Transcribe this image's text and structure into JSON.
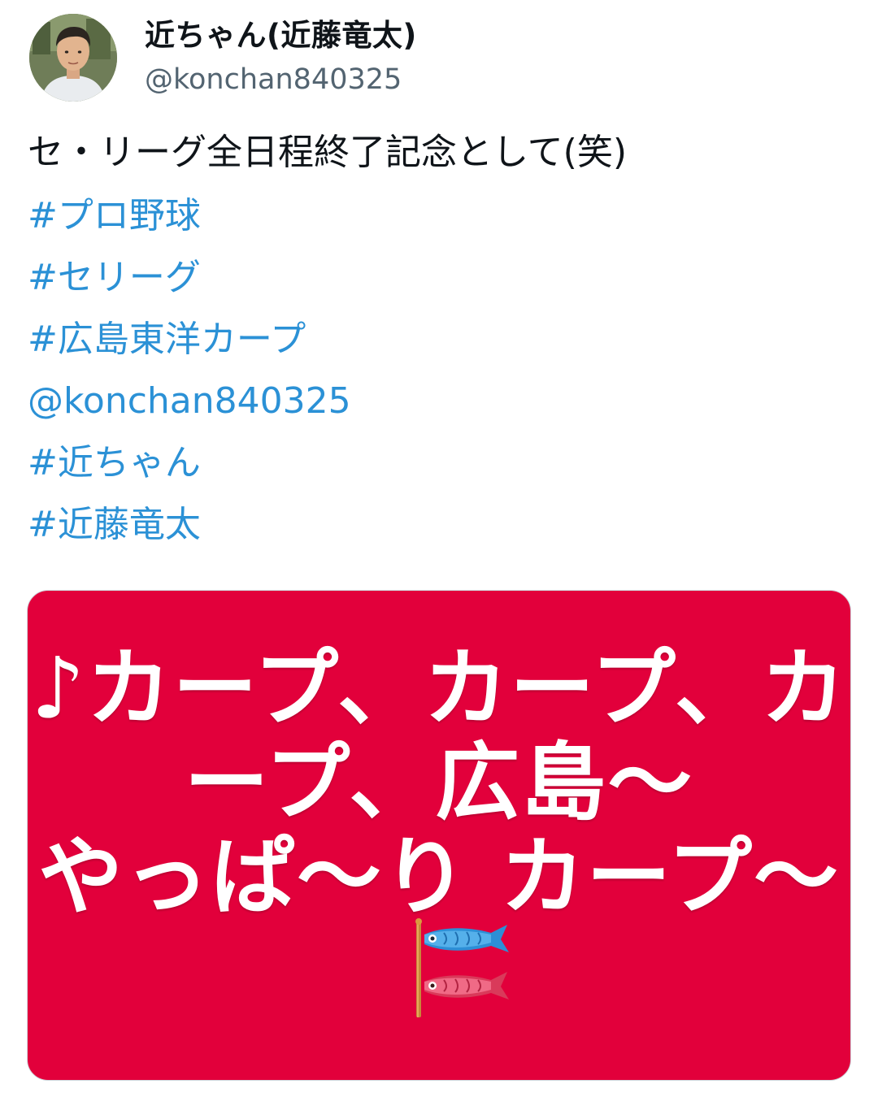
{
  "tweet": {
    "display_name": "近ちゃん(近藤竜太)",
    "handle": "@konchan840325",
    "text": "セ・リーグ全日程終了記念として(笑)",
    "tags": [
      "#プロ野球",
      "#セリーグ",
      "#広島東洋カープ",
      "@konchan840325",
      "#近ちゃん",
      "#近藤竜太"
    ]
  },
  "media": {
    "lines": [
      "♪カープ、カープ、カ",
      "ープ、広島〜",
      "やっぱ〜り カープ〜"
    ],
    "emoji_icon": "carp-streamer-icon",
    "background_color": "#e2003b",
    "text_color": "#ffffff"
  },
  "colors": {
    "link": "#2b91d6",
    "text": "#0f1419",
    "secondary": "#536471"
  }
}
